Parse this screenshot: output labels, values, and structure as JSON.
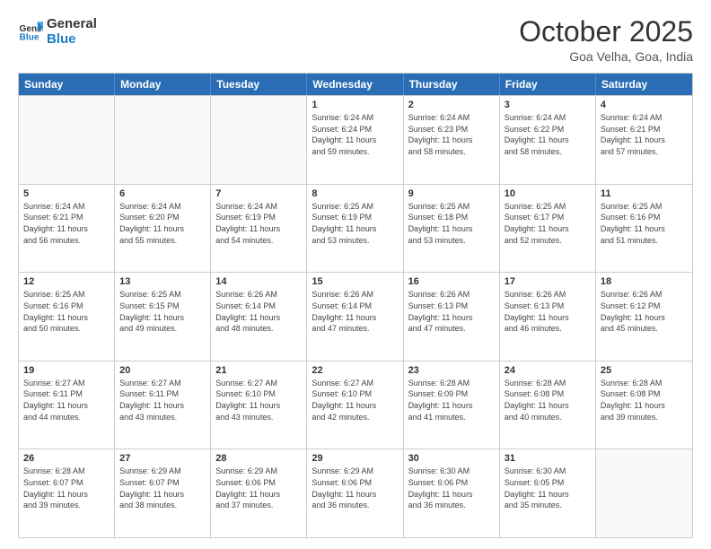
{
  "header": {
    "logo_text_general": "General",
    "logo_text_blue": "Blue",
    "month_title": "October 2025",
    "location": "Goa Velha, Goa, India"
  },
  "weekdays": [
    "Sunday",
    "Monday",
    "Tuesday",
    "Wednesday",
    "Thursday",
    "Friday",
    "Saturday"
  ],
  "weeks": [
    [
      {
        "day": "",
        "info": ""
      },
      {
        "day": "",
        "info": ""
      },
      {
        "day": "",
        "info": ""
      },
      {
        "day": "1",
        "info": "Sunrise: 6:24 AM\nSunset: 6:24 PM\nDaylight: 11 hours\nand 59 minutes."
      },
      {
        "day": "2",
        "info": "Sunrise: 6:24 AM\nSunset: 6:23 PM\nDaylight: 11 hours\nand 58 minutes."
      },
      {
        "day": "3",
        "info": "Sunrise: 6:24 AM\nSunset: 6:22 PM\nDaylight: 11 hours\nand 58 minutes."
      },
      {
        "day": "4",
        "info": "Sunrise: 6:24 AM\nSunset: 6:21 PM\nDaylight: 11 hours\nand 57 minutes."
      }
    ],
    [
      {
        "day": "5",
        "info": "Sunrise: 6:24 AM\nSunset: 6:21 PM\nDaylight: 11 hours\nand 56 minutes."
      },
      {
        "day": "6",
        "info": "Sunrise: 6:24 AM\nSunset: 6:20 PM\nDaylight: 11 hours\nand 55 minutes."
      },
      {
        "day": "7",
        "info": "Sunrise: 6:24 AM\nSunset: 6:19 PM\nDaylight: 11 hours\nand 54 minutes."
      },
      {
        "day": "8",
        "info": "Sunrise: 6:25 AM\nSunset: 6:19 PM\nDaylight: 11 hours\nand 53 minutes."
      },
      {
        "day": "9",
        "info": "Sunrise: 6:25 AM\nSunset: 6:18 PM\nDaylight: 11 hours\nand 53 minutes."
      },
      {
        "day": "10",
        "info": "Sunrise: 6:25 AM\nSunset: 6:17 PM\nDaylight: 11 hours\nand 52 minutes."
      },
      {
        "day": "11",
        "info": "Sunrise: 6:25 AM\nSunset: 6:16 PM\nDaylight: 11 hours\nand 51 minutes."
      }
    ],
    [
      {
        "day": "12",
        "info": "Sunrise: 6:25 AM\nSunset: 6:16 PM\nDaylight: 11 hours\nand 50 minutes."
      },
      {
        "day": "13",
        "info": "Sunrise: 6:25 AM\nSunset: 6:15 PM\nDaylight: 11 hours\nand 49 minutes."
      },
      {
        "day": "14",
        "info": "Sunrise: 6:26 AM\nSunset: 6:14 PM\nDaylight: 11 hours\nand 48 minutes."
      },
      {
        "day": "15",
        "info": "Sunrise: 6:26 AM\nSunset: 6:14 PM\nDaylight: 11 hours\nand 47 minutes."
      },
      {
        "day": "16",
        "info": "Sunrise: 6:26 AM\nSunset: 6:13 PM\nDaylight: 11 hours\nand 47 minutes."
      },
      {
        "day": "17",
        "info": "Sunrise: 6:26 AM\nSunset: 6:13 PM\nDaylight: 11 hours\nand 46 minutes."
      },
      {
        "day": "18",
        "info": "Sunrise: 6:26 AM\nSunset: 6:12 PM\nDaylight: 11 hours\nand 45 minutes."
      }
    ],
    [
      {
        "day": "19",
        "info": "Sunrise: 6:27 AM\nSunset: 6:11 PM\nDaylight: 11 hours\nand 44 minutes."
      },
      {
        "day": "20",
        "info": "Sunrise: 6:27 AM\nSunset: 6:11 PM\nDaylight: 11 hours\nand 43 minutes."
      },
      {
        "day": "21",
        "info": "Sunrise: 6:27 AM\nSunset: 6:10 PM\nDaylight: 11 hours\nand 43 minutes."
      },
      {
        "day": "22",
        "info": "Sunrise: 6:27 AM\nSunset: 6:10 PM\nDaylight: 11 hours\nand 42 minutes."
      },
      {
        "day": "23",
        "info": "Sunrise: 6:28 AM\nSunset: 6:09 PM\nDaylight: 11 hours\nand 41 minutes."
      },
      {
        "day": "24",
        "info": "Sunrise: 6:28 AM\nSunset: 6:08 PM\nDaylight: 11 hours\nand 40 minutes."
      },
      {
        "day": "25",
        "info": "Sunrise: 6:28 AM\nSunset: 6:08 PM\nDaylight: 11 hours\nand 39 minutes."
      }
    ],
    [
      {
        "day": "26",
        "info": "Sunrise: 6:28 AM\nSunset: 6:07 PM\nDaylight: 11 hours\nand 39 minutes."
      },
      {
        "day": "27",
        "info": "Sunrise: 6:29 AM\nSunset: 6:07 PM\nDaylight: 11 hours\nand 38 minutes."
      },
      {
        "day": "28",
        "info": "Sunrise: 6:29 AM\nSunset: 6:06 PM\nDaylight: 11 hours\nand 37 minutes."
      },
      {
        "day": "29",
        "info": "Sunrise: 6:29 AM\nSunset: 6:06 PM\nDaylight: 11 hours\nand 36 minutes."
      },
      {
        "day": "30",
        "info": "Sunrise: 6:30 AM\nSunset: 6:06 PM\nDaylight: 11 hours\nand 36 minutes."
      },
      {
        "day": "31",
        "info": "Sunrise: 6:30 AM\nSunset: 6:05 PM\nDaylight: 11 hours\nand 35 minutes."
      },
      {
        "day": "",
        "info": ""
      }
    ]
  ]
}
